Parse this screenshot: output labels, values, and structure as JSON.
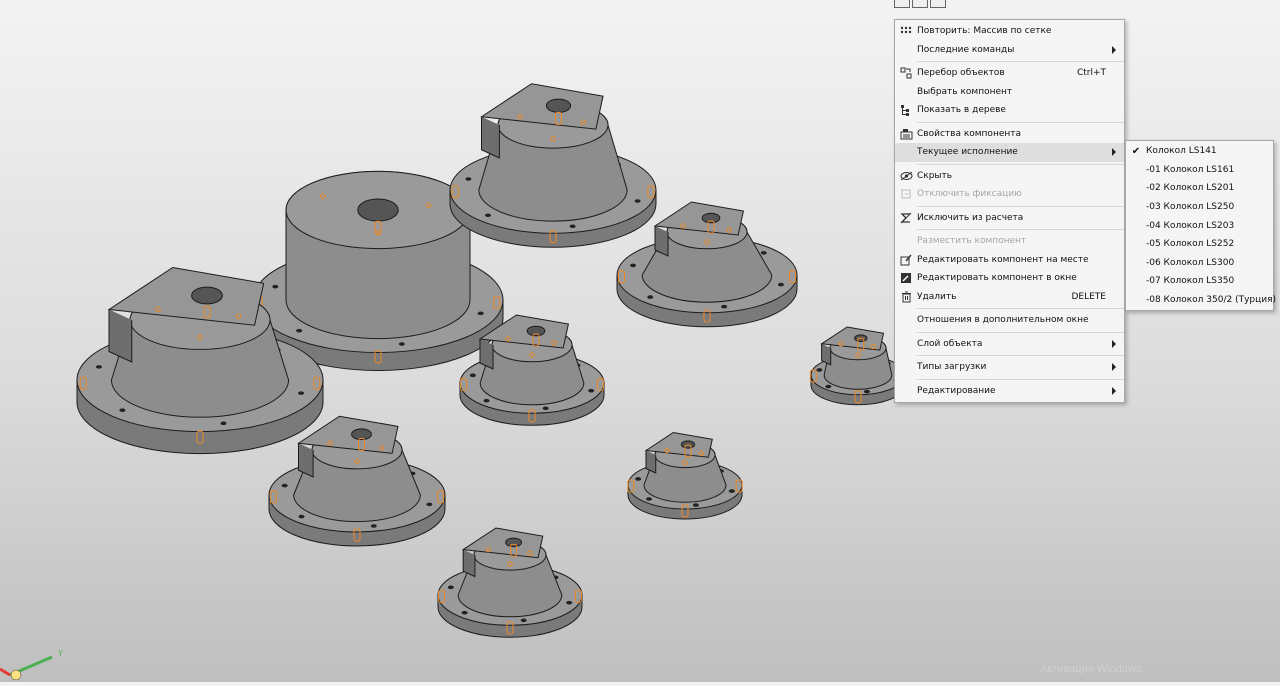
{
  "colors": {
    "part_fill": "#8d8d8d",
    "part_top": "#9a9a9a",
    "part_edge": "#1c1c1c",
    "hole_highlight": "#f08a24",
    "menu_bg": "#f5f5f5",
    "menu_selected": "#dedede",
    "axis_y": "#4caf50",
    "axis_x": "#e53935"
  },
  "context_menu": {
    "items": [
      {
        "label": "Повторить: Массив по сетке",
        "icon": "grid-array-icon",
        "shortcut": "",
        "submenu": false,
        "disabled": false
      },
      {
        "label": "Последние команды",
        "icon": "",
        "shortcut": "",
        "submenu": true,
        "disabled": false
      },
      {
        "sep": true
      },
      {
        "label": "Перебор объектов",
        "icon": "cycle-objects-icon",
        "shortcut": "Ctrl+T",
        "submenu": false,
        "disabled": false
      },
      {
        "label": "Выбрать компонент",
        "icon": "",
        "shortcut": "",
        "submenu": false,
        "disabled": false
      },
      {
        "label": "Показать в дереве",
        "icon": "show-in-tree-icon",
        "shortcut": "",
        "submenu": false,
        "disabled": false
      },
      {
        "sep": true
      },
      {
        "label": "Свойства компонента",
        "icon": "component-properties-icon",
        "shortcut": "",
        "submenu": false,
        "disabled": false
      },
      {
        "label": "Текущее исполнение",
        "icon": "",
        "shortcut": "",
        "submenu": true,
        "disabled": false,
        "selected": true
      },
      {
        "sep": true
      },
      {
        "label": "Скрыть",
        "icon": "hide-eye-icon",
        "shortcut": "",
        "submenu": false,
        "disabled": false
      },
      {
        "label": "Отключить фиксацию",
        "icon": "unfix-icon",
        "shortcut": "",
        "submenu": false,
        "disabled": true
      },
      {
        "sep": true
      },
      {
        "label": "Исключить из расчета",
        "icon": "exclude-calc-icon",
        "shortcut": "",
        "submenu": false,
        "disabled": false
      },
      {
        "sep": true
      },
      {
        "label": "Разместить компонент",
        "icon": "",
        "shortcut": "",
        "submenu": false,
        "disabled": true
      },
      {
        "label": "Редактировать компонент на месте",
        "icon": "edit-in-place-icon",
        "shortcut": "",
        "submenu": false,
        "disabled": false
      },
      {
        "label": "Редактировать компонент в окне",
        "icon": "edit-in-window-icon",
        "shortcut": "",
        "submenu": false,
        "disabled": false
      },
      {
        "label": "Удалить",
        "icon": "delete-icon",
        "shortcut": "DELETE",
        "submenu": false,
        "disabled": false
      },
      {
        "sep": true
      },
      {
        "label": "Отношения в дополнительном окне",
        "icon": "",
        "shortcut": "",
        "submenu": false,
        "disabled": false
      },
      {
        "sep": true
      },
      {
        "label": "Слой объекта",
        "icon": "",
        "shortcut": "",
        "submenu": true,
        "disabled": false
      },
      {
        "sep": true
      },
      {
        "label": "Типы загрузки",
        "icon": "",
        "shortcut": "",
        "submenu": true,
        "disabled": false
      },
      {
        "sep": true
      },
      {
        "label": "Редактирование",
        "icon": "",
        "shortcut": "",
        "submenu": true,
        "disabled": false
      }
    ]
  },
  "submenu": {
    "items": [
      {
        "label": "Колокол LS141",
        "checked": true
      },
      {
        "label": "-01 Колокол LS161",
        "checked": false
      },
      {
        "label": "-02 Колокол LS201",
        "checked": false
      },
      {
        "label": "-03 Колокол LS250",
        "checked": false
      },
      {
        "label": "-04 Колокол LS203",
        "checked": false
      },
      {
        "label": "-05 Колокол LS252",
        "checked": false
      },
      {
        "label": "-06 Колокол LS300",
        "checked": false
      },
      {
        "label": "-07 Колокол LS350",
        "checked": false
      },
      {
        "label": "-08 Колокол 350/2 (Турция)",
        "checked": false
      }
    ]
  },
  "axis": {
    "y_label": "Y"
  },
  "watermark": "Активация Windows"
}
